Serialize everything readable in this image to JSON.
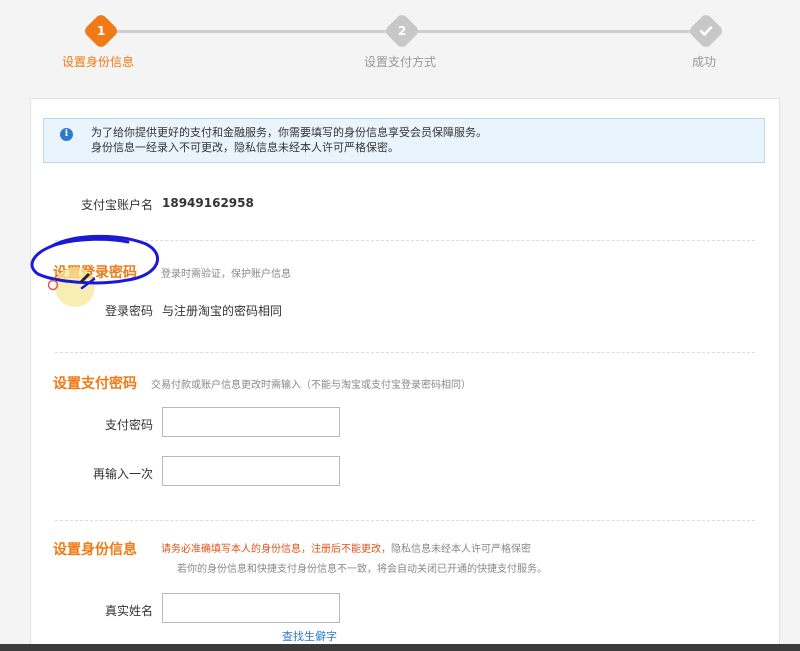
{
  "steps": [
    {
      "number": "1",
      "label": "设置身份信息",
      "state": "active"
    },
    {
      "number": "2",
      "label": "设置支付方式",
      "state": "pending"
    },
    {
      "icon": "check-icon",
      "label": "成功",
      "state": "pending"
    }
  ],
  "notice": {
    "icon": "info-icon",
    "line1": "为了给你提供更好的支付和金融服务，你需要填写的身份信息享受会员保障服务。",
    "line2": "身份信息一经录入不可更改，隐私信息未经本人许可严格保密。"
  },
  "account": {
    "label": "支付宝账户名",
    "value": "18949162958"
  },
  "login_password": {
    "title": "设置登录密码",
    "hint": "登录时需验证，保护账户信息",
    "field_label": "登录密码",
    "field_value": "与注册淘宝的密码相同"
  },
  "pay_password": {
    "title": "设置支付密码",
    "hint": "交易付款或账户信息更改时需输入（不能与淘宝或支付宝登录密码相同）",
    "field1_label": "支付密码",
    "field2_label": "再输入一次"
  },
  "identity": {
    "title": "设置身份信息",
    "hint_warn": "请务必准确填写本人的身份信息，注册后不能更改，",
    "hint_rest": "隐私信息未经本人许可严格保密",
    "hint_line2": "若你的身份信息和快捷支付身份信息不一致，将会自动关闭已开通的快捷支付服务。",
    "name_label": "真实姓名",
    "lookup_link": "查找生僻字"
  },
  "colors": {
    "accent": "#f07a16",
    "info_bg": "#eaf4fd",
    "link": "#2a7bd4",
    "annotation": "#1a1ad6"
  }
}
